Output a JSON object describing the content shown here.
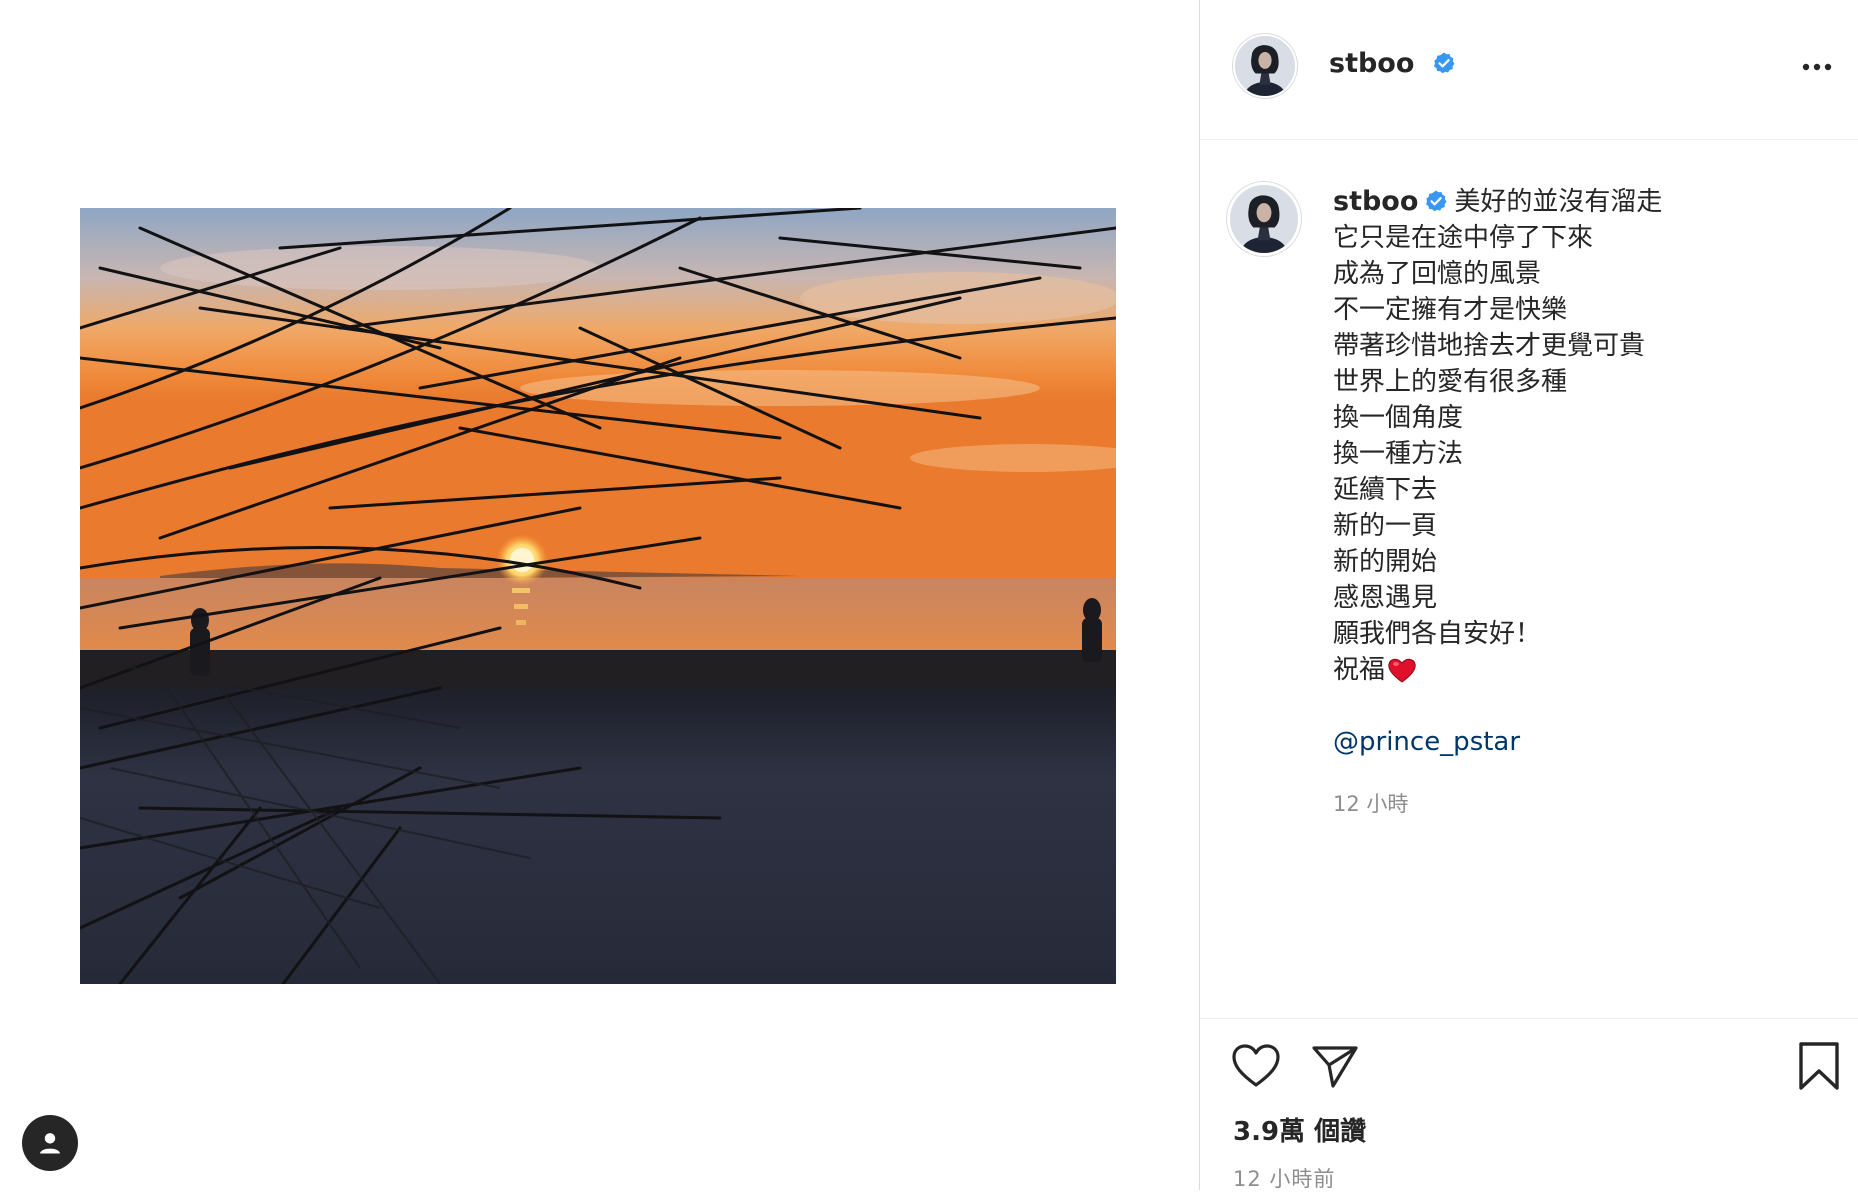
{
  "post": {
    "username": "stboo",
    "verified": true,
    "caption_lines": [
      "美好的並沒有溜走",
      "它只是在途中停了下來",
      "成為了回憶的風景",
      "不一定擁有才是快樂",
      "帶著珍惜地捨去才更覺可貴",
      "世界上的愛有很多種",
      "換一個角度",
      "換一種方法",
      "延續下去",
      "新的一頁",
      "新的開始",
      "感恩遇見",
      "願我們各自安好！",
      "祝福"
    ],
    "mention": "@prince_pstar",
    "caption_time": "12 小時",
    "likes": "3.9萬 個讚",
    "post_time": "12 小時前"
  },
  "icons": {
    "verified": "verified-badge-icon",
    "more": "more-options-icon",
    "like": "heart-icon",
    "share": "paper-plane-icon",
    "save": "bookmark-icon",
    "emoji": "red-heart-emoji",
    "account": "account-icon"
  },
  "colors": {
    "verified_blue": "#3897f0",
    "mention_link": "#00376b",
    "muted_text": "#8e8e8e",
    "primary_text": "#262626"
  }
}
